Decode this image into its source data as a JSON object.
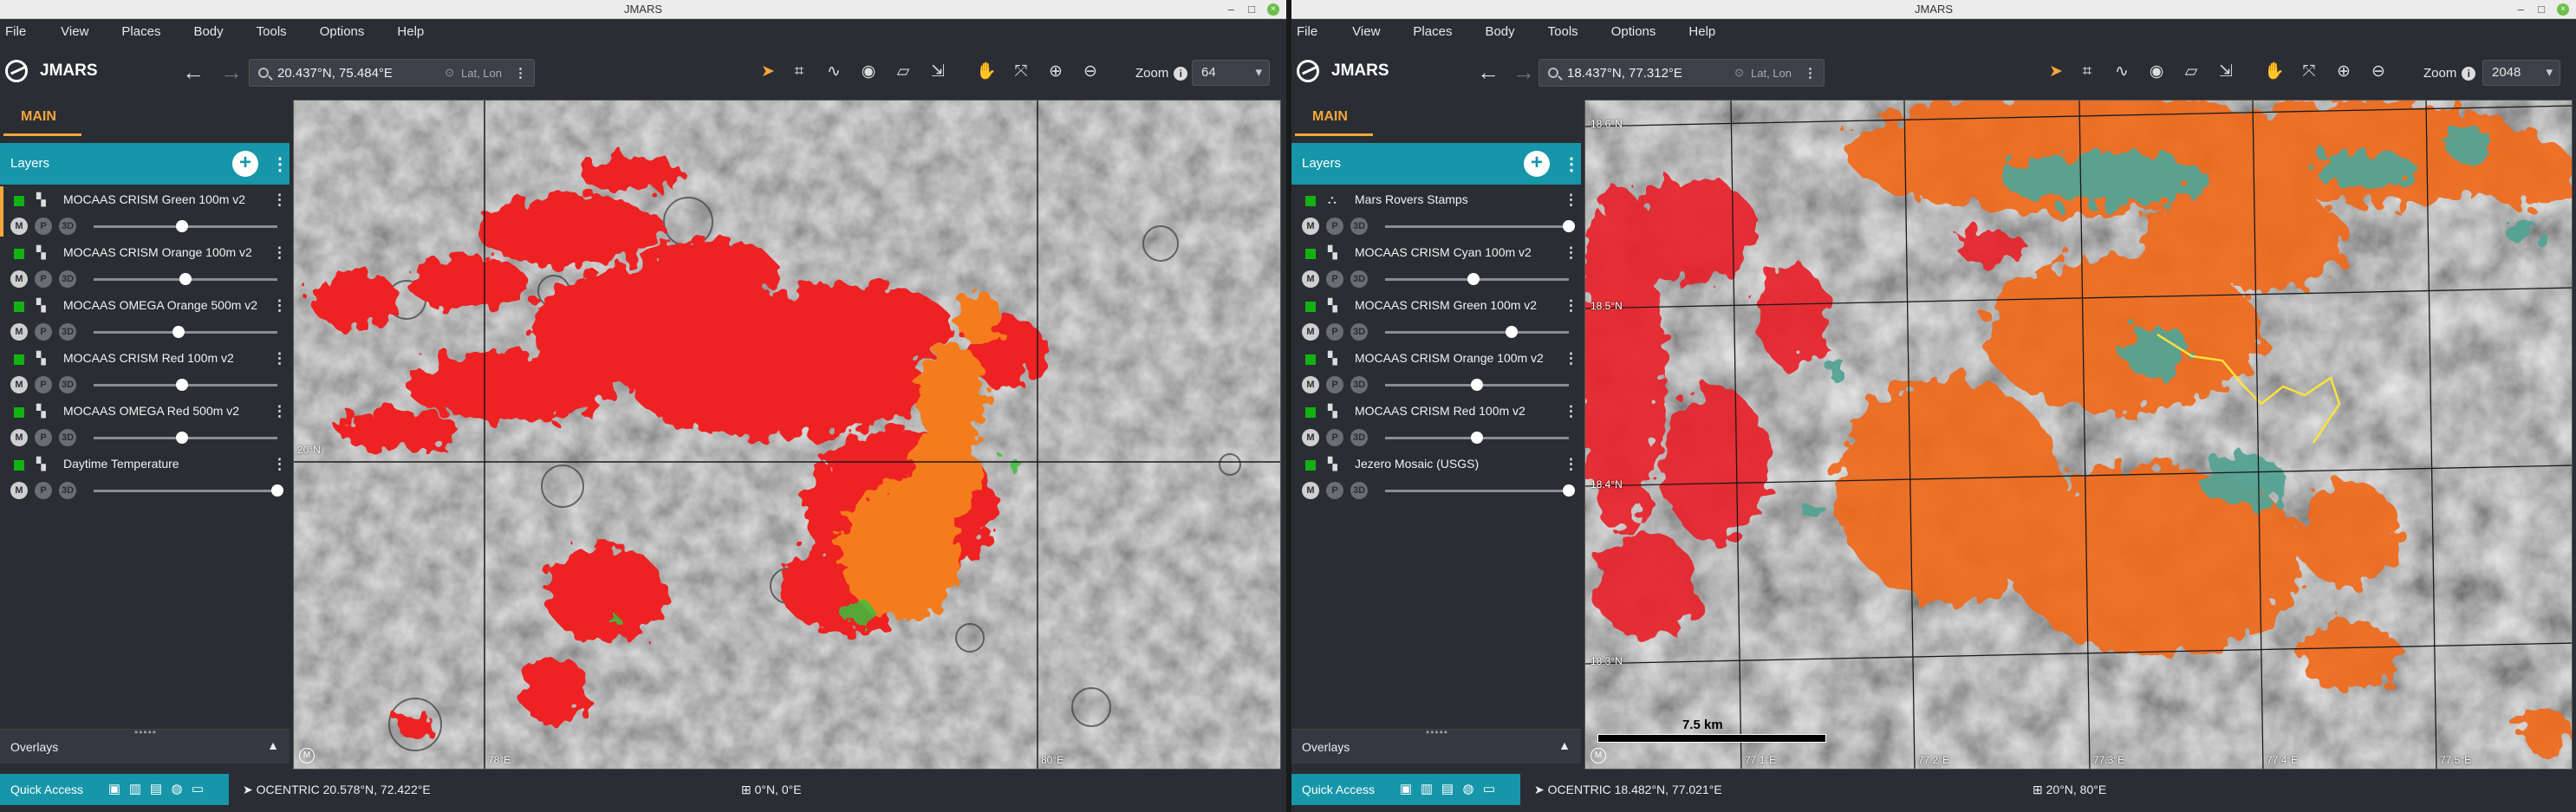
{
  "windows": [
    {
      "title": "JMARS",
      "menu": [
        "File",
        "View",
        "Places",
        "Body",
        "Tools",
        "Options",
        "Help"
      ],
      "app_name": "JMARS",
      "search": {
        "value": "20.437°N, 75.484°E",
        "mode": "Lat, Lon"
      },
      "zoom": {
        "label": "Zoom",
        "value": "64"
      },
      "tab": "MAIN",
      "layers_title": "Layers",
      "layers": [
        {
          "name": "MOCAAS CRISM Green 100m v2",
          "opacity": 0.48,
          "selected": true,
          "type": "map"
        },
        {
          "name": "MOCAAS CRISM Orange 100m v2",
          "opacity": 0.5,
          "selected": false,
          "type": "map"
        },
        {
          "name": "MOCAAS OMEGA Orange 500m v2",
          "opacity": 0.46,
          "selected": false,
          "type": "map"
        },
        {
          "name": "MOCAAS CRISM Red 100m v2",
          "opacity": 0.48,
          "selected": false,
          "type": "map"
        },
        {
          "name": "MOCAAS OMEGA Red 500m v2",
          "opacity": 0.48,
          "selected": false,
          "type": "map"
        },
        {
          "name": "Daytime Temperature",
          "opacity": 1.0,
          "selected": false,
          "type": "map"
        }
      ],
      "overlays": "Overlays",
      "quick_access": "Quick Access",
      "cursor_readout": "OCENTRIC  20.578°N, 72.422°E",
      "center_readout": "0°N, 0°E",
      "grid_labels": {
        "lat": "20°N",
        "lon1": "78°E",
        "lon2": "80°E"
      },
      "badge": "M"
    },
    {
      "title": "JMARS",
      "menu": [
        "File",
        "View",
        "Places",
        "Body",
        "Tools",
        "Options",
        "Help"
      ],
      "app_name": "JMARS",
      "search": {
        "value": "18.437°N, 77.312°E",
        "mode": "Lat, Lon"
      },
      "zoom": {
        "label": "Zoom",
        "value": "2048"
      },
      "tab": "MAIN",
      "layers_title": "Layers",
      "layers": [
        {
          "name": "Mars Rovers Stamps",
          "opacity": 1.0,
          "selected": false,
          "type": "stamp"
        },
        {
          "name": "MOCAAS CRISM Cyan 100m v2",
          "opacity": 0.48,
          "selected": false,
          "type": "map"
        },
        {
          "name": "MOCAAS CRISM Green 100m v2",
          "opacity": 0.69,
          "selected": false,
          "type": "map"
        },
        {
          "name": "MOCAAS CRISM Orange 100m v2",
          "opacity": 0.5,
          "selected": false,
          "type": "map"
        },
        {
          "name": "MOCAAS CRISM Red 100m v2",
          "opacity": 0.5,
          "selected": false,
          "type": "map"
        },
        {
          "name": "Jezero Mosaic (USGS)",
          "opacity": 1.0,
          "selected": false,
          "type": "map"
        }
      ],
      "overlays": "Overlays",
      "quick_access": "Quick Access",
      "cursor_readout": "OCENTRIC  18.482°N, 77.021°E",
      "center_readout": "20°N, 80°E",
      "grid_labels": {
        "lat1": "18.6°N",
        "lat2": "18.5°N",
        "lat3": "18.4°N",
        "lat4": "18.3°N",
        "lon1": "77.1°E",
        "lon2": "77.2°E",
        "lon3": "77.3°E",
        "lon4": "77.4°E",
        "lon5": "77.5°E"
      },
      "scale": "7.5 km",
      "badge": "M"
    }
  ],
  "colors": {
    "accent": "#f4a63a",
    "panel_header": "#1696a8",
    "layer_on": "#13b213"
  }
}
